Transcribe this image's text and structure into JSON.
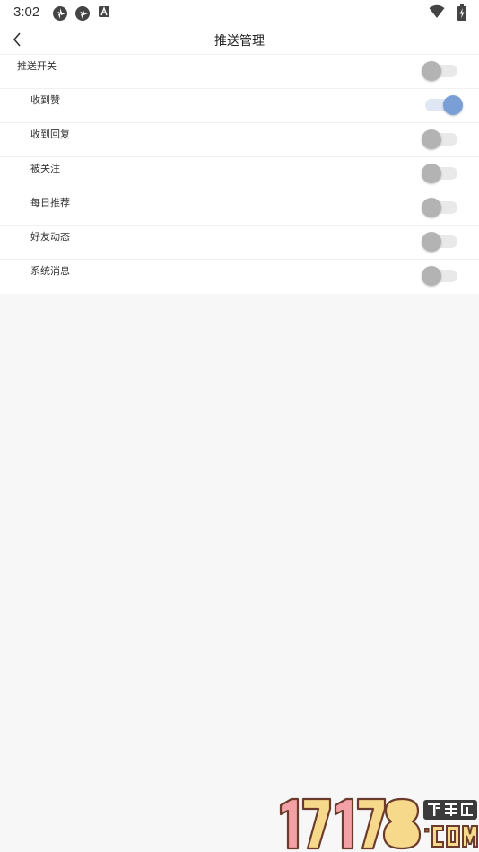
{
  "status_bar": {
    "time": "3:02"
  },
  "header": {
    "title": "推送管理",
    "back_icon": "chevron-left-icon"
  },
  "settings": [
    {
      "label": "推送开关",
      "level": "top",
      "enabled": false
    },
    {
      "label": "收到赞",
      "level": "sub",
      "enabled": true
    },
    {
      "label": "收到回复",
      "level": "sub",
      "enabled": false
    },
    {
      "label": "被关注",
      "level": "sub",
      "enabled": false
    },
    {
      "label": "每日推荐",
      "level": "sub",
      "enabled": false
    },
    {
      "label": "好友动态",
      "level": "sub",
      "enabled": false
    },
    {
      "label": "系统消息",
      "level": "sub",
      "enabled": false
    }
  ],
  "watermark": {
    "text": "17178",
    "badge": "下载站",
    "suffix": ".COM"
  },
  "colors": {
    "accent": "#7a9fd6",
    "knob_off": "#b3b3b3",
    "track_off": "#e9e9e9",
    "background": "#f7f7f7"
  }
}
